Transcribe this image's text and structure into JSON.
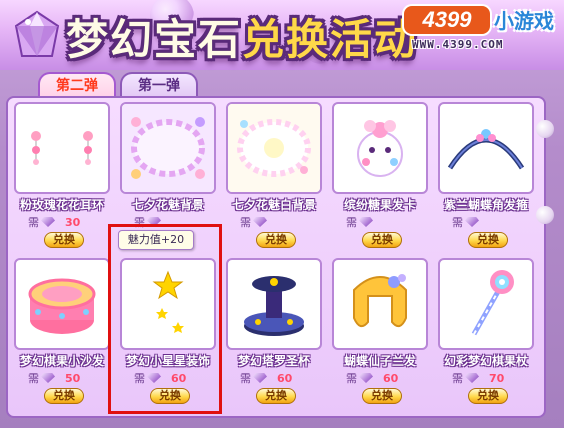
{
  "banner": {
    "title_part1": "梦幻宝石",
    "title_part2": "兑换活动",
    "logo_brand": "4399",
    "logo_text": "小游戏",
    "logo_url": "WWW.4399.COM"
  },
  "tabs": [
    {
      "label": "第二弹",
      "active": true
    },
    {
      "label": "第一弹",
      "active": false
    }
  ],
  "tooltip": "魅力值+20",
  "price_prefix": "需",
  "redeem_label": "兑换",
  "items": [
    {
      "name": "粉玫瑰花花耳环",
      "price": "30",
      "icon": "pink-rose-earrings-icon"
    },
    {
      "name": "七夕花魅背景",
      "price": "",
      "icon": "qixi-flower-background-icon"
    },
    {
      "name": "七夕花魅白背景",
      "price": "",
      "icon": "qixi-white-background-icon"
    },
    {
      "name": "缤纷糖果发卡",
      "price": "",
      "icon": "candy-hairclip-icon"
    },
    {
      "name": "紫兰蝴蝶角发箍",
      "price": "",
      "icon": "butterfly-headband-icon"
    },
    {
      "name": "梦幻棋果小沙发",
      "price": "50",
      "icon": "candy-sofa-icon"
    },
    {
      "name": "梦幻小星星装饰",
      "price": "60",
      "icon": "star-decoration-icon"
    },
    {
      "name": "梦幻塔罗圣杯",
      "price": "60",
      "icon": "tarot-cup-icon"
    },
    {
      "name": "蝴蝶仙子兰发",
      "price": "60",
      "icon": "fairy-hair-icon"
    },
    {
      "name": "幻彩梦幻棋果杖",
      "price": "70",
      "icon": "candy-wand-icon"
    }
  ],
  "colors": {
    "accent": "#a55ad0",
    "button": "#ffd84a",
    "highlight": "#e01010",
    "price": "#ff4a6b"
  }
}
